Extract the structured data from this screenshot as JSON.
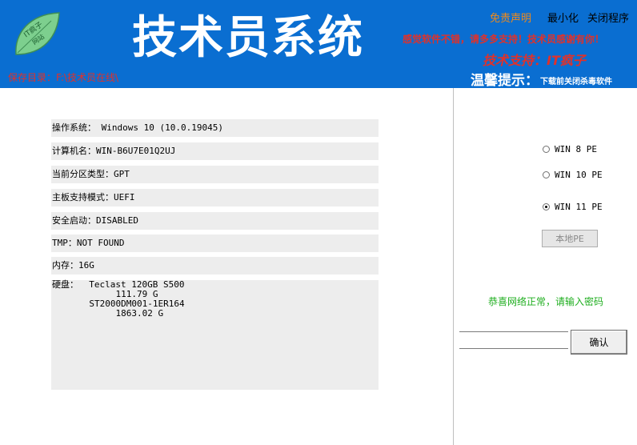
{
  "header": {
    "logo_text_top": "IT疯子",
    "logo_text_bottom": "网站",
    "title": "技术员系统",
    "save_dir": "保存目录：F:\\技术员在线\\",
    "links": {
      "disclaimer": "免责声明",
      "minimize": "最小化",
      "close": "关闭程序"
    },
    "slogan": "感觉软件不错，请多多支持！技术员感谢有你！",
    "support": "技术支持：IT疯子",
    "tip_title": "温馨提示：",
    "tip_text": "下载前关闭杀毒软件"
  },
  "system_info": {
    "os": "操作系统： Windows 10 (10.0.19045)",
    "computer_name": "计算机名：WIN-B6U7E01Q2UJ",
    "partition_type": "当前分区类型：GPT",
    "board_mode": "主板支持模式：UEFI",
    "secure_boot": "安全启动：DISABLED",
    "tmp": "TMP：NOT FOUND",
    "memory": "内存：16G",
    "disk": "硬盘：  Teclast 120GB S500\n            111.79 G\n       ST2000DM001-1ER164\n            1863.02 G"
  },
  "pe_options": [
    {
      "label": "WIN 8 PE",
      "selected": false
    },
    {
      "label": "WIN 10 PE",
      "selected": false
    },
    {
      "label": "WIN 11 PE",
      "selected": true
    }
  ],
  "local_pe_label": "本地PE",
  "network_status": "恭喜网络正常，请输入密码",
  "password_value": "",
  "confirm_label": "确认",
  "colors": {
    "header_blue": "#0a6ed1",
    "accent_red": "#e0312a",
    "status_green": "#1fae1f"
  }
}
